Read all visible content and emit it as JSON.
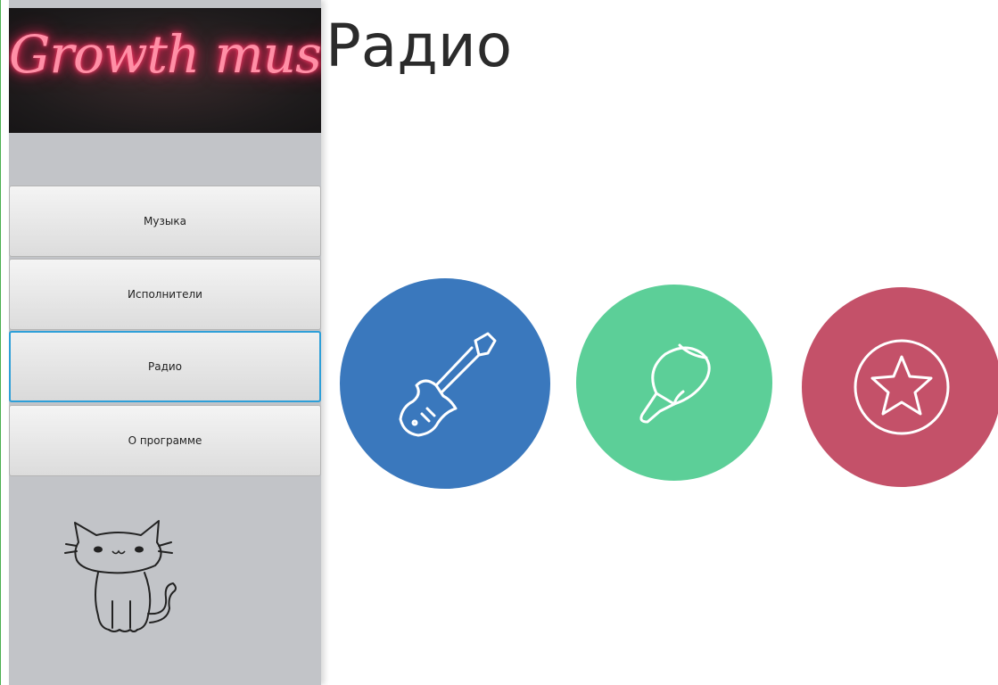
{
  "app": {
    "logo_text": "Growth music"
  },
  "sidebar": {
    "items": [
      {
        "label": "Музыка",
        "active": false
      },
      {
        "label": "Исполнители",
        "active": false
      },
      {
        "label": "Радио",
        "active": true
      },
      {
        "label": "О программе",
        "active": false
      }
    ]
  },
  "main": {
    "title": "Радио",
    "stations": [
      {
        "icon": "guitar-icon",
        "color": "#3a78bd"
      },
      {
        "icon": "cap-icon",
        "color": "#5ccf98"
      },
      {
        "icon": "star-icon",
        "color": "#c45169"
      }
    ]
  },
  "colors": {
    "sidebar_bg": "#c2c4c8",
    "active_border": "#2e9fd8",
    "logo_neon": "#ff3f6c"
  }
}
